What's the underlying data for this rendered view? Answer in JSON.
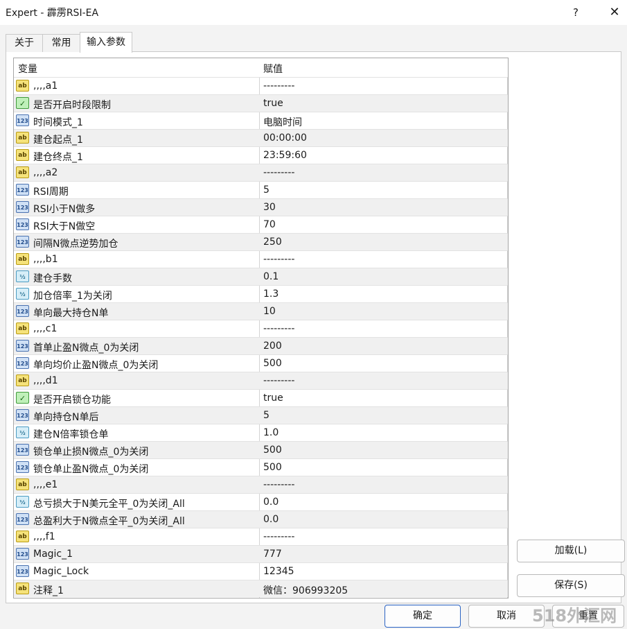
{
  "window": {
    "title": "Expert - 霹雳RSI-EA",
    "help": "?",
    "close": "✕"
  },
  "tabs": [
    {
      "label": "关于"
    },
    {
      "label": "常用"
    },
    {
      "label": "输入参数"
    }
  ],
  "grid": {
    "header": {
      "variable": "变量",
      "value": "赋值"
    },
    "rows": [
      {
        "type": "ab",
        "name": ",,,,a1",
        "value": "---------"
      },
      {
        "type": "bool",
        "name": "是否开启时段限制",
        "value": "true"
      },
      {
        "type": "123",
        "name": "时间模式_1",
        "value": "电脑时间"
      },
      {
        "type": "ab",
        "name": "建仓起点_1",
        "value": "00:00:00"
      },
      {
        "type": "ab",
        "name": "建仓终点_1",
        "value": "23:59:60"
      },
      {
        "type": "ab",
        "name": ",,,,a2",
        "value": "---------"
      },
      {
        "type": "123",
        "name": "RSI周期",
        "value": "5"
      },
      {
        "type": "123",
        "name": "RSI小于N做多",
        "value": "30"
      },
      {
        "type": "123",
        "name": "RSI大于N做空",
        "value": "70"
      },
      {
        "type": "123",
        "name": "间隔N微点逆势加仓",
        "value": "250"
      },
      {
        "type": "ab",
        "name": ",,,,b1",
        "value": "---------"
      },
      {
        "type": "dbl",
        "name": "建仓手数",
        "value": "0.1"
      },
      {
        "type": "dbl",
        "name": "加仓倍率_1为关闭",
        "value": "1.3"
      },
      {
        "type": "123",
        "name": "单向最大持仓N单",
        "value": "10"
      },
      {
        "type": "ab",
        "name": ",,,,c1",
        "value": "---------"
      },
      {
        "type": "123",
        "name": "首单止盈N微点_0为关闭",
        "value": "200"
      },
      {
        "type": "123",
        "name": "单向均价止盈N微点_0为关闭",
        "value": "500"
      },
      {
        "type": "ab",
        "name": ",,,,d1",
        "value": "---------"
      },
      {
        "type": "bool",
        "name": "是否开启锁仓功能",
        "value": "true"
      },
      {
        "type": "123",
        "name": "单向持仓N单后",
        "value": "5"
      },
      {
        "type": "dbl",
        "name": "建仓N倍率锁仓单",
        "value": "1.0"
      },
      {
        "type": "123",
        "name": "锁仓单止损N微点_0为关闭",
        "value": "500"
      },
      {
        "type": "123",
        "name": "锁仓单止盈N微点_0为关闭",
        "value": "500"
      },
      {
        "type": "ab",
        "name": ",,,,e1",
        "value": "---------"
      },
      {
        "type": "dbl",
        "name": "总亏损大于N美元全平_0为关闭_All",
        "value": "0.0"
      },
      {
        "type": "123",
        "name": "总盈利大于N微点全平_0为关闭_All",
        "value": "0.0"
      },
      {
        "type": "ab",
        "name": ",,,,f1",
        "value": "---------"
      },
      {
        "type": "123",
        "name": "Magic_1",
        "value": "777"
      },
      {
        "type": "123",
        "name": "Magic_Lock",
        "value": "12345"
      },
      {
        "type": "ab",
        "name": "注释_1",
        "value": "微信：906993205"
      }
    ]
  },
  "icons": {
    "ab": "ab",
    "123": "123",
    "dbl": "½",
    "bool": "✓"
  },
  "buttons": {
    "load": "加载(L)",
    "save": "保存(S)",
    "ok": "确定",
    "cancel": "取消",
    "reset": "重置"
  },
  "watermark": "518外汇网"
}
